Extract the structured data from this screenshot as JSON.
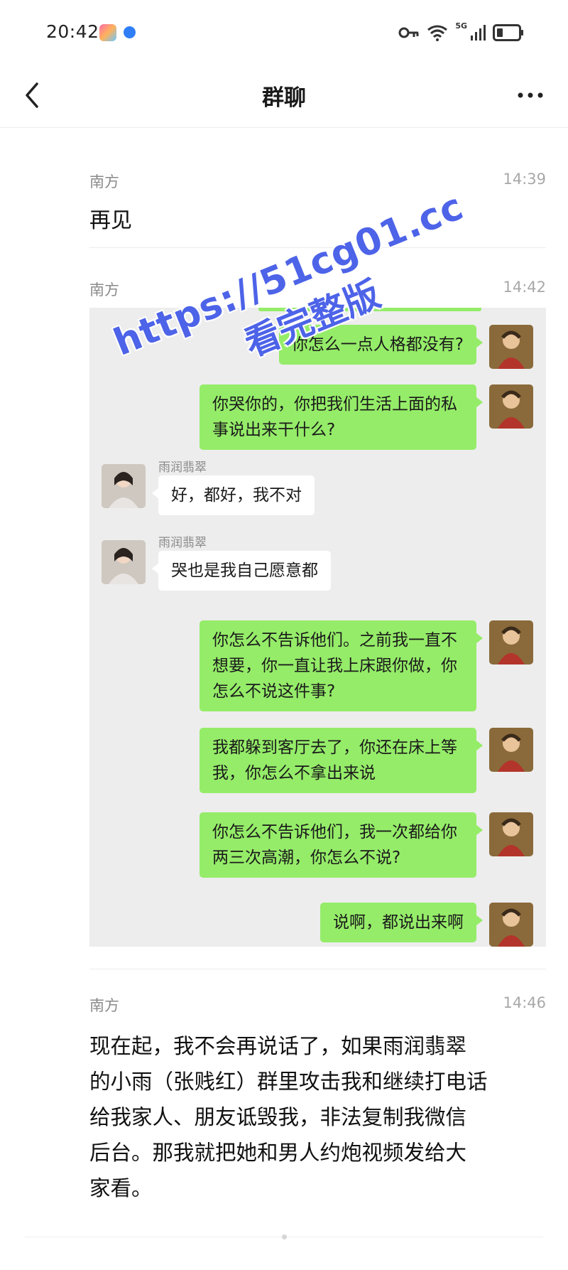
{
  "status_bar": {
    "time": "20:42",
    "network_label": "5G",
    "icons": [
      "app-store-icon",
      "browser-icon",
      "key-icon",
      "wifi-icon",
      "signal-icon",
      "battery-icon"
    ]
  },
  "header": {
    "title": "群聊",
    "back_icon": "chevron-left-icon",
    "more_icon": "more-dots-icon"
  },
  "messages": [
    {
      "sender": "南方",
      "time": "14:39",
      "text": "再见"
    },
    {
      "sender": "南方",
      "time": "14:42",
      "type": "chat-screenshot",
      "chat": [
        {
          "side": "right",
          "text": "你怎么一点人格都没有?"
        },
        {
          "side": "right",
          "lines": [
            "你哭你的，你把我们生活上面的私",
            "事说出来干什么?"
          ]
        },
        {
          "side": "left",
          "sender": "雨润翡翠",
          "text": "好，都好，我不对"
        },
        {
          "side": "left",
          "sender": "雨润翡翠",
          "text": "哭也是我自己愿意都"
        },
        {
          "side": "right",
          "lines": [
            "你怎么不告诉他们。之前我一直不",
            "想要，你一直让我上床跟你做，你",
            "怎么不说这件事?"
          ]
        },
        {
          "side": "right",
          "lines": [
            "我都躲到客厅去了，你还在床上等",
            "我，你怎么不拿出来说"
          ]
        },
        {
          "side": "right",
          "lines": [
            "你怎么不告诉他们，我一次都给你",
            "两三次高潮，你怎么不说?"
          ]
        },
        {
          "side": "right",
          "text": "说啊，都说出来啊"
        }
      ]
    },
    {
      "sender": "南方",
      "time": "14:46",
      "lines": [
        "现在起，我不会再说话了，如果雨润翡翠",
        "的小雨（张贱红）群里攻击我和继续打电话",
        "给我家人、朋友诋毁我，非法复制我微信",
        "后台。那我就把她和男人约炮视频发给大",
        "家看。"
      ]
    }
  ],
  "watermark": {
    "url": "https://51cg01.cc",
    "subtitle": "看完整版"
  },
  "colors": {
    "bubble_green": "#95ec69",
    "panel_bg": "#ededed",
    "watermark_blue": "#4d63e8"
  }
}
